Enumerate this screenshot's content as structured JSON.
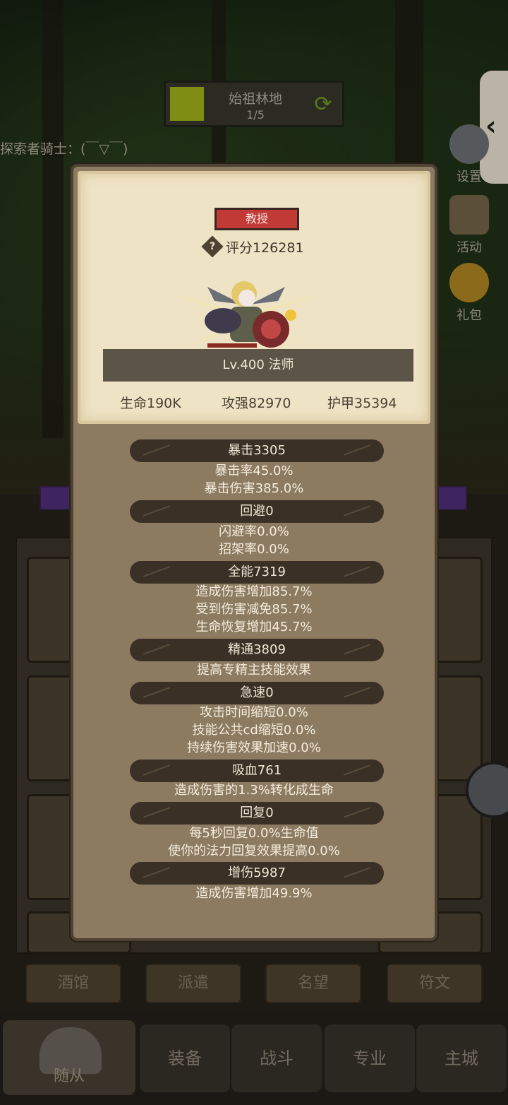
{
  "location": {
    "name": "始祖林地",
    "progress": "1/5"
  },
  "explorer_text": "探索者骑士：(￣▽￣)",
  "side_menu": [
    {
      "label": "设置",
      "icon": "gear-icon"
    },
    {
      "label": "活动",
      "icon": "scroll-icon"
    },
    {
      "label": "礼包",
      "icon": "gift-icon"
    }
  ],
  "popup": {
    "rank": "教授",
    "score": "评分126281",
    "level_class": "Lv.400 法师",
    "stats": [
      "生命190K",
      "攻强82970",
      "护甲35394"
    ],
    "attributes": [
      {
        "header": "暴击3305",
        "lines": [
          "暴击率45.0%",
          "暴击伤害385.0%"
        ]
      },
      {
        "header": "回避0",
        "lines": [
          "闪避率0.0%",
          "招架率0.0%"
        ]
      },
      {
        "header": "全能7319",
        "lines": [
          "造成伤害增加85.7%",
          "受到伤害减免85.7%",
          "生命恢复增加45.7%"
        ]
      },
      {
        "header": "精通3809",
        "lines": [
          "提高专精主技能效果"
        ]
      },
      {
        "header": "急速0",
        "lines": [
          "攻击时间缩短0.0%",
          "技能公共cd缩短0.0%",
          "持续伤害效果加速0.0%"
        ]
      },
      {
        "header": "吸血761",
        "lines": [
          "造成伤害的1.3%转化成生命"
        ]
      },
      {
        "header": "回复0",
        "lines": [
          "每5秒回复0.0%生命值",
          "使你的法力回复效果提高0.0%"
        ]
      },
      {
        "header": "增伤5987",
        "lines": [
          "造成伤害增加49.9%"
        ]
      }
    ]
  },
  "bottom_buttons": [
    "酒馆",
    "派遣",
    "名望",
    "符文"
  ],
  "nav_tabs": [
    "随从",
    "装备",
    "战斗",
    "专业",
    "主城"
  ]
}
